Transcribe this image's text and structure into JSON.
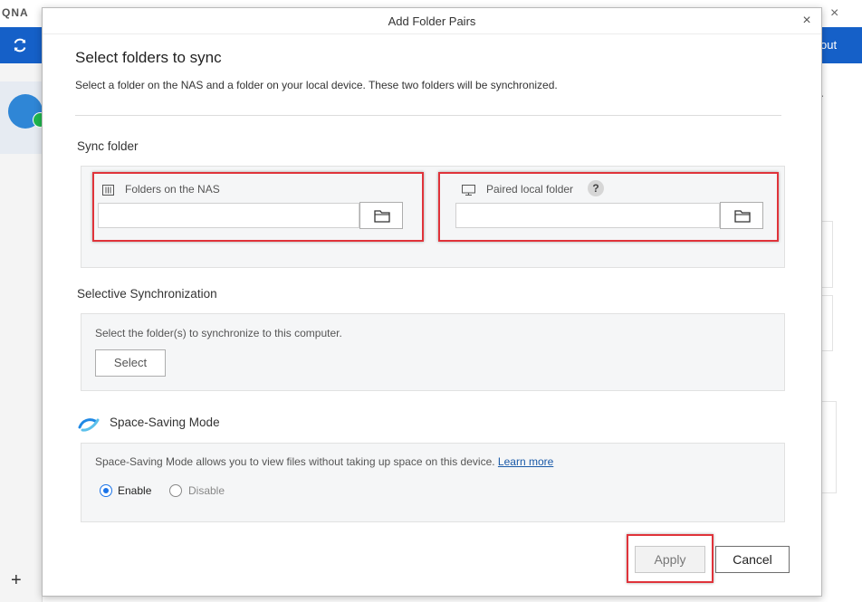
{
  "background": {
    "logo_text": "QNA",
    "right_button_label": "out",
    "right_text": "."
  },
  "dialog": {
    "title": "Add Folder Pairs",
    "heading": "Select folders to sync",
    "description": "Select a folder on the NAS and a folder on your local device. These two folders will be synchronized.",
    "sync_folder": {
      "section_label": "Sync folder",
      "nas_label": "Folders on the NAS",
      "nas_value": "",
      "local_label": "Paired local folder",
      "local_value": "",
      "help_glyph": "?"
    },
    "selective_sync": {
      "section_label": "Selective Synchronization",
      "description": "Select the folder(s) to synchronize to this computer.",
      "select_label": "Select"
    },
    "space_saving": {
      "section_label": "Space-Saving Mode",
      "description": "Space-Saving Mode allows you to view files without taking up space on this device.",
      "learn_more": "Learn more",
      "options": [
        {
          "label": "Enable",
          "selected": true
        },
        {
          "label": "Disable",
          "selected": false
        }
      ]
    },
    "buttons": {
      "apply": "Apply",
      "cancel": "Cancel"
    }
  },
  "colors": {
    "accent": "#1560c8",
    "highlight": "#e0333a",
    "link": "#1a5aa8",
    "success": "#1fb64d"
  },
  "icons": [
    "close-icon",
    "refresh-icon",
    "nas-icon",
    "monitor-icon",
    "folder-icon",
    "space-saving-icon",
    "plus-icon",
    "help-icon"
  ]
}
